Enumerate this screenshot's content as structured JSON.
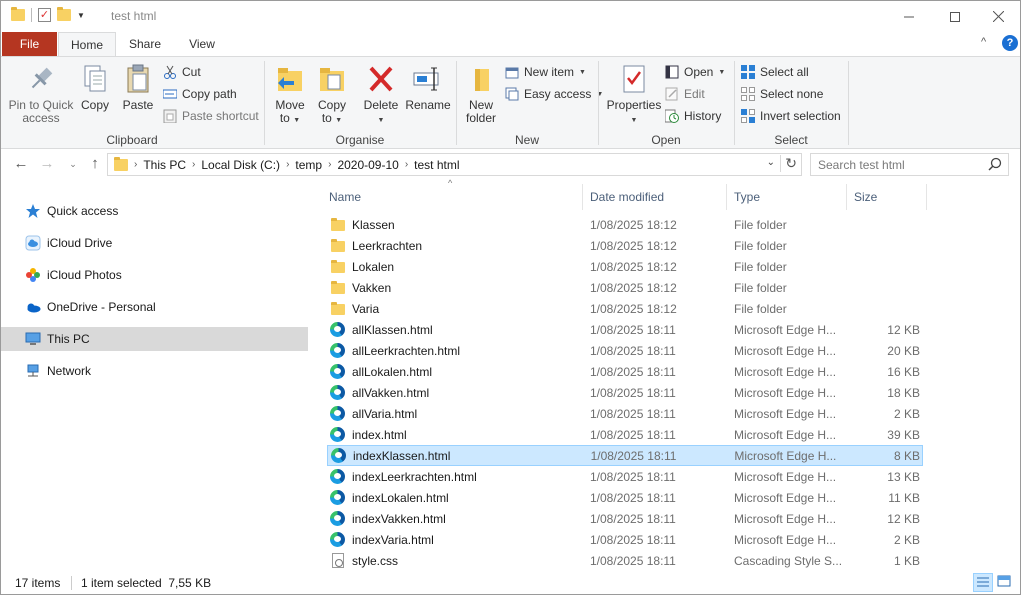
{
  "window": {
    "title": "test html",
    "controls": {
      "minimize": "—",
      "maximize": "□",
      "close": "✕"
    }
  },
  "ribbon": {
    "tabs": [
      {
        "label": "File"
      },
      {
        "label": "Home"
      },
      {
        "label": "Share"
      },
      {
        "label": "View"
      }
    ],
    "clipboard": {
      "label": "Clipboard",
      "pin_line1": "Pin to Quick",
      "pin_line2": "access",
      "copy": "Copy",
      "paste": "Paste",
      "cut": "Cut",
      "copy_path": "Copy path",
      "paste_shortcut": "Paste shortcut"
    },
    "organise": {
      "label": "Organise",
      "move_to_line1": "Move",
      "move_to_line2": "to",
      "copy_to_line1": "Copy",
      "copy_to_line2": "to",
      "delete": "Delete",
      "rename": "Rename"
    },
    "new": {
      "label": "New",
      "new_folder_line1": "New",
      "new_folder_line2": "folder",
      "new_item": "New item",
      "easy_access": "Easy access"
    },
    "open": {
      "label": "Open",
      "properties": "Properties",
      "open": "Open",
      "edit": "Edit",
      "history": "History"
    },
    "select": {
      "label": "Select",
      "select_all": "Select all",
      "select_none": "Select none",
      "invert_selection": "Invert selection"
    }
  },
  "address": {
    "segments": [
      "This PC",
      "Local Disk (C:)",
      "temp",
      "2020-09-10",
      "test html"
    ],
    "search_placeholder": "Search test html"
  },
  "nav": {
    "items": [
      {
        "label": "Quick access",
        "icon": "star-icon"
      },
      {
        "label": "iCloud Drive",
        "icon": "icloud-drive-icon"
      },
      {
        "label": "iCloud Photos",
        "icon": "icloud-photos-icon"
      },
      {
        "label": "OneDrive - Personal",
        "icon": "onedrive-icon"
      },
      {
        "label": "This PC",
        "icon": "this-pc-icon",
        "selected": true
      },
      {
        "label": "Network",
        "icon": "network-icon"
      }
    ]
  },
  "columns": {
    "name": "Name",
    "date": "Date modified",
    "type": "Type",
    "size": "Size"
  },
  "files": [
    {
      "name": "Klassen",
      "date": "1/08/2025 18:12",
      "type": "File folder",
      "size": "",
      "icon": "folder-icon"
    },
    {
      "name": "Leerkrachten",
      "date": "1/08/2025 18:12",
      "type": "File folder",
      "size": "",
      "icon": "folder-icon"
    },
    {
      "name": "Lokalen",
      "date": "1/08/2025 18:12",
      "type": "File folder",
      "size": "",
      "icon": "folder-icon"
    },
    {
      "name": "Vakken",
      "date": "1/08/2025 18:12",
      "type": "File folder",
      "size": "",
      "icon": "folder-icon"
    },
    {
      "name": "Varia",
      "date": "1/08/2025 18:12",
      "type": "File folder",
      "size": "",
      "icon": "folder-icon"
    },
    {
      "name": "allKlassen.html",
      "date": "1/08/2025 18:11",
      "type": "Microsoft Edge H...",
      "size": "12 KB",
      "icon": "edge-icon"
    },
    {
      "name": "allLeerkrachten.html",
      "date": "1/08/2025 18:11",
      "type": "Microsoft Edge H...",
      "size": "20 KB",
      "icon": "edge-icon"
    },
    {
      "name": "allLokalen.html",
      "date": "1/08/2025 18:11",
      "type": "Microsoft Edge H...",
      "size": "16 KB",
      "icon": "edge-icon"
    },
    {
      "name": "allVakken.html",
      "date": "1/08/2025 18:11",
      "type": "Microsoft Edge H...",
      "size": "18 KB",
      "icon": "edge-icon"
    },
    {
      "name": "allVaria.html",
      "date": "1/08/2025 18:11",
      "type": "Microsoft Edge H...",
      "size": "2 KB",
      "icon": "edge-icon"
    },
    {
      "name": "index.html",
      "date": "1/08/2025 18:11",
      "type": "Microsoft Edge H...",
      "size": "39 KB",
      "icon": "edge-icon"
    },
    {
      "name": "indexKlassen.html",
      "date": "1/08/2025 18:11",
      "type": "Microsoft Edge H...",
      "size": "8 KB",
      "icon": "edge-icon",
      "selected": true
    },
    {
      "name": "indexLeerkrachten.html",
      "date": "1/08/2025 18:11",
      "type": "Microsoft Edge H...",
      "size": "13 KB",
      "icon": "edge-icon"
    },
    {
      "name": "indexLokalen.html",
      "date": "1/08/2025 18:11",
      "type": "Microsoft Edge H...",
      "size": "11 KB",
      "icon": "edge-icon"
    },
    {
      "name": "indexVakken.html",
      "date": "1/08/2025 18:11",
      "type": "Microsoft Edge H...",
      "size": "12 KB",
      "icon": "edge-icon"
    },
    {
      "name": "indexVaria.html",
      "date": "1/08/2025 18:11",
      "type": "Microsoft Edge H...",
      "size": "2 KB",
      "icon": "edge-icon"
    },
    {
      "name": "style.css",
      "date": "1/08/2025 18:11",
      "type": "Cascading Style S...",
      "size": "1 KB",
      "icon": "css-file-icon"
    }
  ],
  "status": {
    "item_count": "17 items",
    "selection": "1 item selected  7,55 KB"
  },
  "colors": {
    "file_tab": "#b53621",
    "selection_bg": "#cce8ff",
    "selection_border": "#99d1ff",
    "nav_selected_bg": "#d9d9d9",
    "column_header_text": "#4c607a"
  }
}
